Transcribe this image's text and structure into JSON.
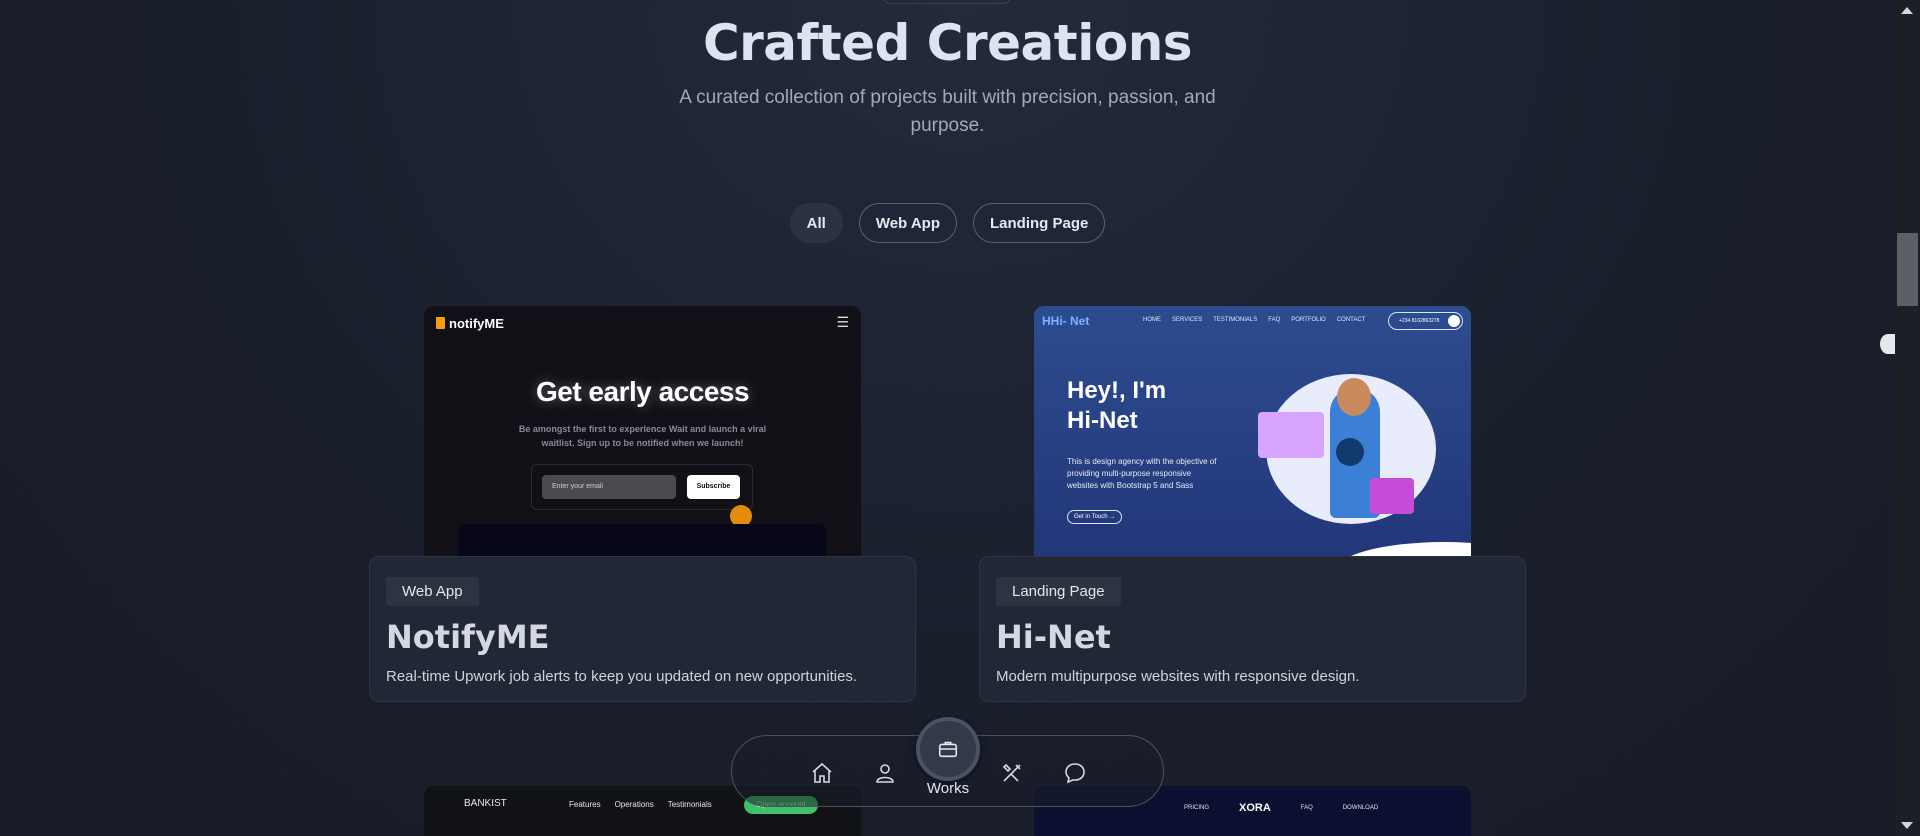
{
  "header": {
    "title": "Crafted Creations",
    "subtitle": "A curated collection of projects built with precision, passion, and purpose."
  },
  "filters": [
    {
      "label": "All",
      "active": true
    },
    {
      "label": "Web App",
      "active": false
    },
    {
      "label": "Landing Page",
      "active": false
    }
  ],
  "projects": [
    {
      "tag": "Web App",
      "title": "NotifyME",
      "description": "Real-time Upwork job alerts to keep you updated on new opportunities.",
      "preview": {
        "logo": "notifyME",
        "heading": "Get early access",
        "text": "Be amongst the first to experience Wait and launch a viral waitlist. Sign up to be notified when we launch!",
        "email_placeholder": "Enter your email",
        "button": "Subscribe"
      }
    },
    {
      "tag": "Landing Page",
      "title": "Hi-Net",
      "description": "Modern multipurpose websites with responsive design.",
      "preview": {
        "logo": "Hi- Net",
        "nav": [
          "HOME",
          "SERVICES",
          "TESTIMONIALS",
          "FAQ",
          "PORTFOLIO",
          "CONTACT"
        ],
        "phone": "+234 8162863278",
        "heading_line1": "Hey!, I'm",
        "heading_line2": "Hi-Net",
        "text": "This is design agency with the objective of providing multi-purpose responsive websites with Bootstrap 5 and Sass",
        "button": "Get in Touch →"
      }
    }
  ],
  "more_previews": {
    "bankist": {
      "logo": "BANKIST",
      "nav": [
        "Features",
        "Operations",
        "Testimonials"
      ],
      "button": "Open account"
    },
    "xora": {
      "nav_left": "PRICING",
      "brand": "XORA",
      "nav_mid": "FAQ",
      "nav_right": "DOWNLOAD"
    }
  },
  "dock": {
    "items": [
      {
        "icon": "home-icon"
      },
      {
        "icon": "user-icon"
      },
      {
        "icon": "briefcase-icon",
        "label": "Works",
        "active": true
      },
      {
        "icon": "tools-icon"
      },
      {
        "icon": "chat-icon"
      }
    ]
  }
}
